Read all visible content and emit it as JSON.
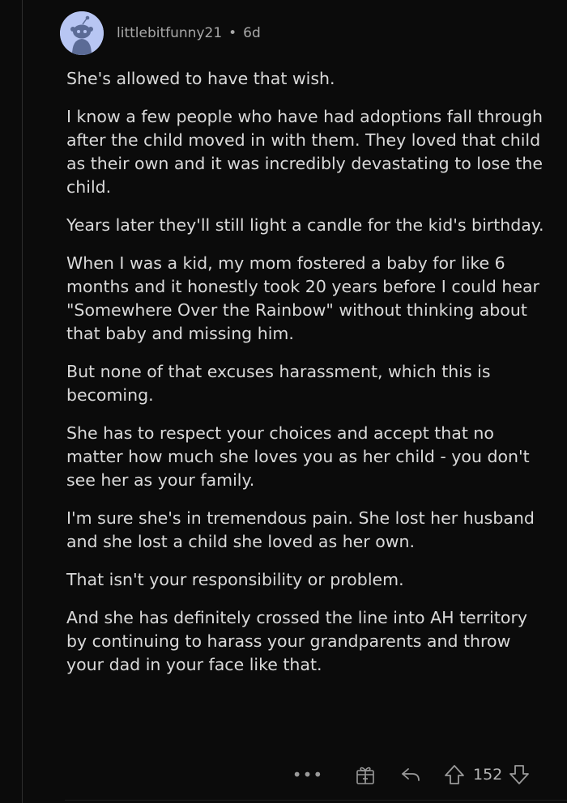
{
  "comment": {
    "username": "littlebitfunny21",
    "separator": "•",
    "age": "6d",
    "paragraphs": [
      "She's allowed to have that wish.",
      "I know a few people who have had adoptions fall through after the child moved in with them.  They loved that child as their own and it was incredibly devastating to lose the child.",
      "Years later they'll still light a candle for the kid's birthday.",
      "When I was a kid, my mom fostered a baby for like 6 months and it honestly took 20 years before I could hear \"Somewhere Over the Rainbow\" without thinking about that baby and missing him.",
      "But none of that excuses harassment, which this is becoming.",
      "She has to respect your choices and accept that no matter how much she loves you as her child - you don't see her as your family.",
      "I'm sure she's in tremendous pain.  She lost her husband and she lost a child she loved as her own.",
      "That isn't your responsibility or problem.",
      "And she has definitely crossed the line into AH territory by continuing to harass your grandparents and throw your dad in your face like that."
    ]
  },
  "actions": {
    "more_label": "•••",
    "score": "152"
  },
  "icons": {
    "avatar": "snoo-avatar-icon",
    "more": "more-options-icon",
    "award": "award-icon",
    "reply": "reply-icon",
    "upvote": "upvote-icon",
    "downvote": "downvote-icon"
  },
  "colors": {
    "background": "#0b0b0b",
    "text": "#dadada",
    "meta": "#a8a8a8",
    "avatar_bg": "#b8c6f3"
  }
}
